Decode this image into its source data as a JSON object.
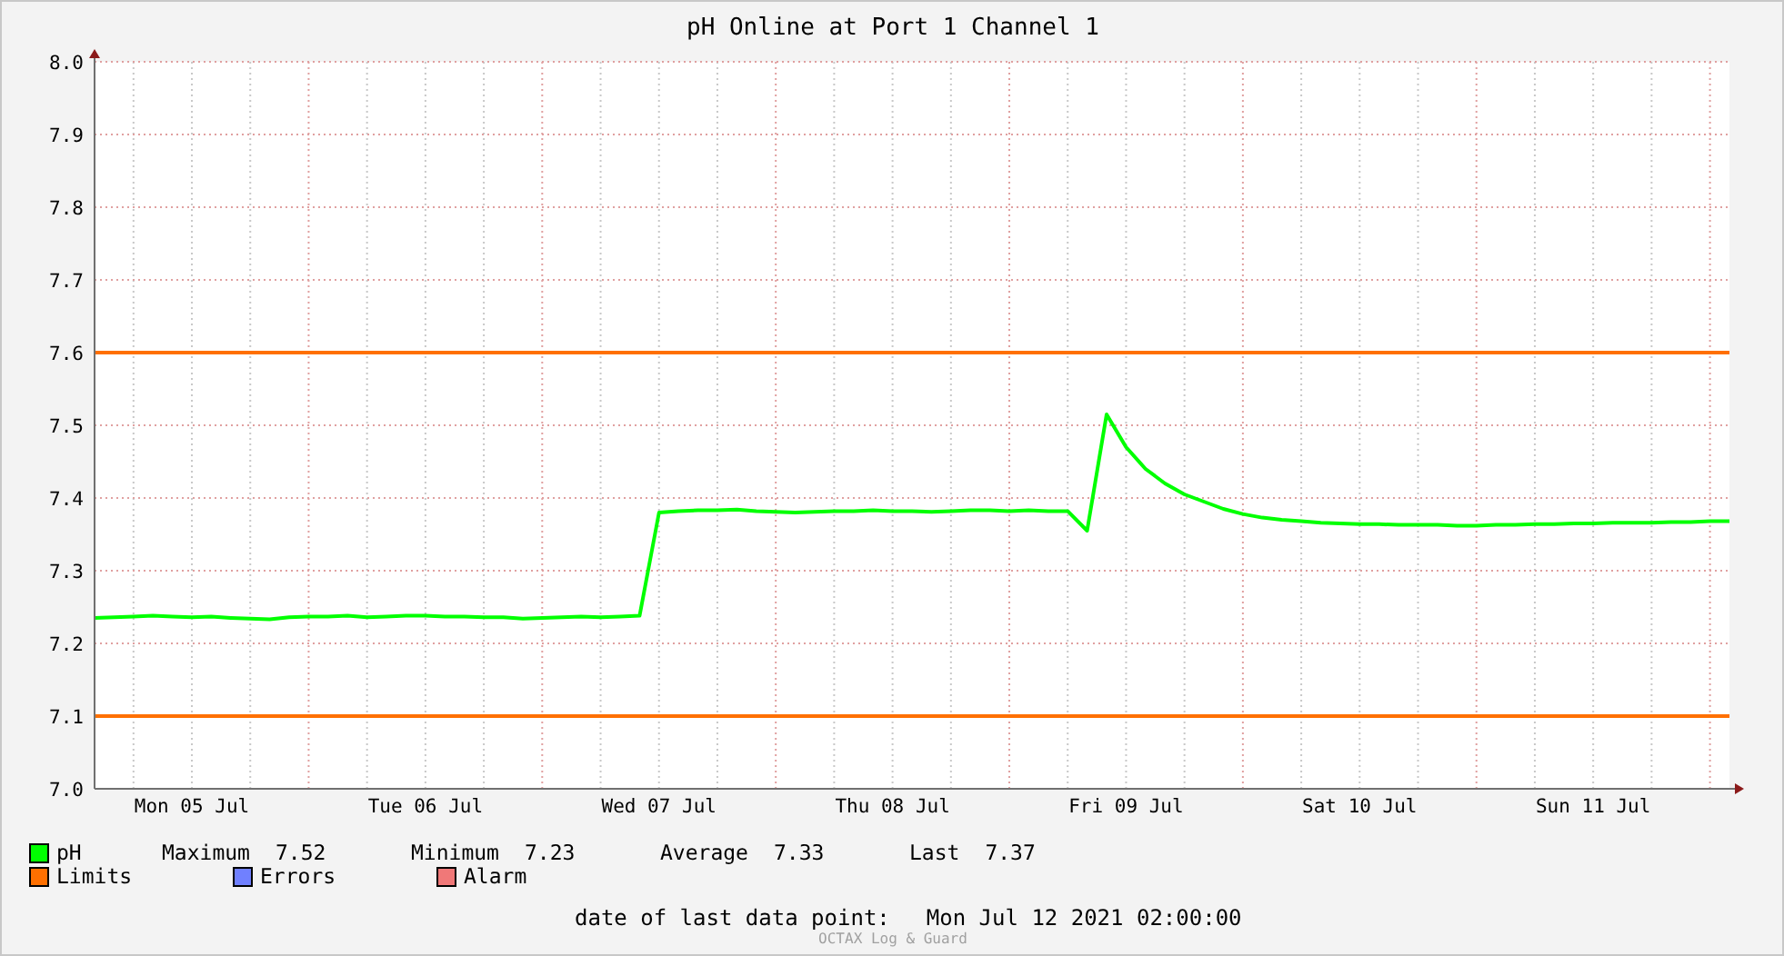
{
  "title": "pH Online at Port 1 Channel 1",
  "chart": {
    "chart_data": {
      "type": "line",
      "grid": true,
      "ylim": [
        7.0,
        8.0
      ],
      "categories": [
        null,
        null,
        null,
        null,
        null,
        "Mon 05 Jul",
        null,
        null,
        null,
        null,
        null,
        null,
        null,
        null,
        null,
        null,
        null,
        "Tue 06 Jul",
        null,
        null,
        null,
        null,
        null,
        null,
        null,
        null,
        null,
        null,
        null,
        "Wed 07 Jul",
        null,
        null,
        null,
        null,
        null,
        null,
        null,
        null,
        null,
        null,
        null,
        "Thu 08 Jul",
        null,
        null,
        null,
        null,
        null,
        null,
        null,
        null,
        null,
        null,
        null,
        "Fri 09 Jul",
        null,
        null,
        null,
        null,
        null,
        null,
        null,
        null,
        null,
        null,
        null,
        "Sat 10 Jul",
        null,
        null,
        null,
        null,
        null,
        null,
        null,
        null,
        null,
        null,
        null,
        "Sun 11 Jul",
        null,
        null,
        null,
        null,
        null,
        null,
        null
      ],
      "yticks": [
        {
          "value": 7,
          "label": "7.0"
        },
        7.1,
        7.2,
        7.3,
        7.4,
        7.5,
        7.6,
        7.7,
        7.8,
        7.9,
        {
          "value": 8,
          "label": "8.0"
        }
      ],
      "series": [
        {
          "name": "pH",
          "color": "#00ff00",
          "values": [
            7.235,
            7.236,
            7.237,
            7.238,
            7.237,
            7.236,
            7.237,
            7.235,
            7.234,
            7.233,
            7.236,
            7.237,
            7.237,
            7.238,
            7.236,
            7.237,
            7.238,
            7.238,
            7.237,
            7.237,
            7.236,
            7.236,
            7.234,
            7.235,
            7.236,
            7.237,
            7.236,
            7.237,
            7.238,
            7.38,
            7.382,
            7.383,
            7.383,
            7.384,
            7.382,
            7.381,
            7.38,
            7.381,
            7.382,
            7.382,
            7.383,
            7.382,
            7.382,
            7.381,
            7.382,
            7.383,
            7.383,
            7.382,
            7.383,
            7.382,
            7.382,
            7.355,
            7.515,
            7.47,
            7.44,
            7.42,
            7.405,
            7.395,
            7.385,
            7.378,
            7.373,
            7.37,
            7.368,
            7.366,
            7.365,
            7.364,
            7.364,
            7.363,
            7.363,
            7.363,
            7.362,
            7.362,
            7.363,
            7.363,
            7.364,
            7.364,
            7.365,
            7.365,
            7.366,
            7.366,
            7.366,
            7.367,
            7.367,
            7.368,
            7.368
          ]
        }
      ],
      "ref_lines": [
        {
          "axis": "y",
          "value": 7.6,
          "color": "#ff7000"
        },
        {
          "axis": "y",
          "value": 7.1,
          "color": "#ff7000"
        }
      ]
    }
  },
  "legend": [
    {
      "label": "Limits",
      "color": "#ff7000"
    },
    {
      "label": "Errors",
      "color": "#7080ff"
    },
    {
      "label": "Alarm",
      "color": "#f07878"
    }
  ],
  "stats": [
    {
      "label": "Maximum",
      "value": "7.52"
    },
    {
      "label": "Minimum",
      "value": "7.23"
    },
    {
      "label": "Average",
      "value": "7.33"
    },
    {
      "label": "Last",
      "value": "7.37"
    }
  ],
  "last_data_point": {
    "label": "date of last data point:",
    "value": "Mon Jul 12 2021 02:00:00"
  },
  "credit": "OCTAX Log & Guard"
}
